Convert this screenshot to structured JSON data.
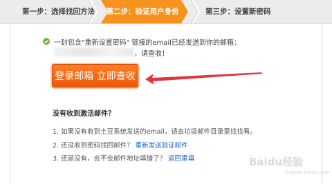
{
  "steps": [
    {
      "label": "第一步：选择找回方法"
    },
    {
      "label": "第二步：验证用户身份"
    },
    {
      "label": "第三步：设置新密码"
    }
  ],
  "notice": {
    "line1": "一封包含\"重新设置密码\" 链接的email已经发送到你的邮箱：",
    "line2_suffix": "，请查收！"
  },
  "login_button": "登录邮箱  立即查收",
  "help": {
    "title": "没有收到激活邮件？",
    "item1": "1. 如果没有收到土豆系统发送的email，请去垃圾邮件目录里找找看。",
    "item2_prefix": "2. 还没收到密码找回邮件？",
    "item2_link": "重新发送验证邮件",
    "item3_prefix": "3. 还是没有，会不会邮件地址填错了？",
    "item3_link": "返回重填"
  },
  "watermark": {
    "main": "Baidu经验",
    "sub": "jingyan.baidu.com"
  },
  "colors": {
    "active_step": "#f7921e",
    "button": "#ea5a0c",
    "success": "#6bb631",
    "link": "#1467c7",
    "arrow": "#e0353b"
  }
}
